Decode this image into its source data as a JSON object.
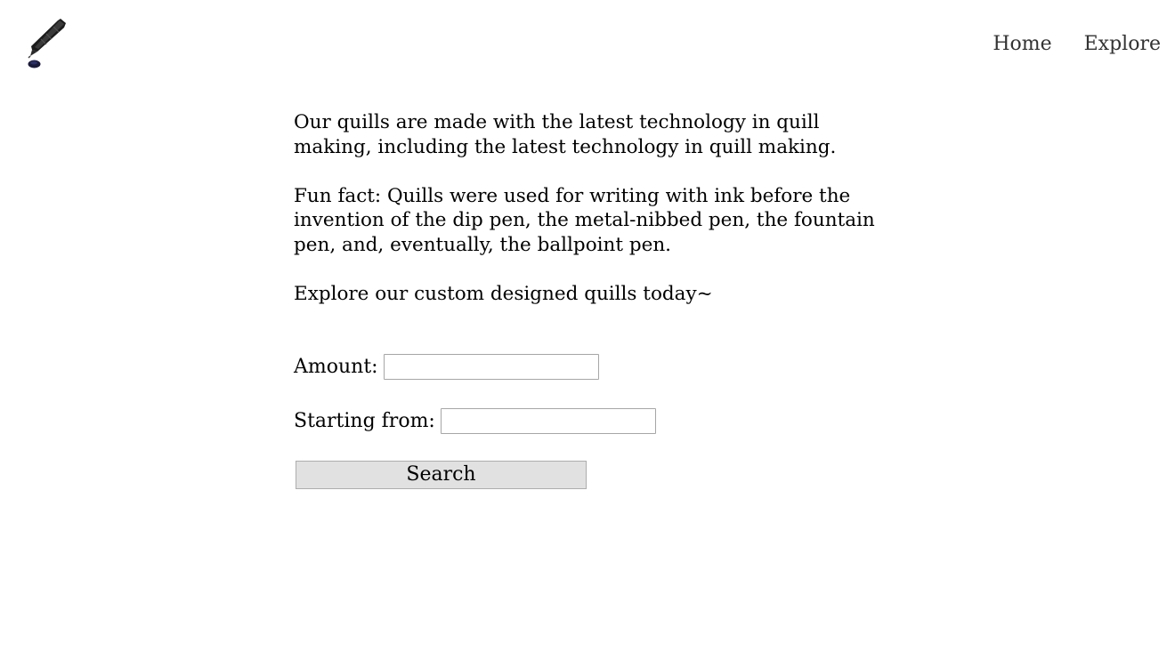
{
  "nav": {
    "items": [
      {
        "label": "Home"
      },
      {
        "label": "Explore"
      }
    ]
  },
  "logo": {
    "icon": "quill-pen-icon"
  },
  "content": {
    "paragraph_1": "Our quills are made with the latest technology in quill making, including the latest technology in quill making.",
    "paragraph_2": "Fun fact: Quills were used for writing with ink before the invention of the dip pen, the metal-nibbed pen, the fountain pen, and, eventually, the ballpoint pen.",
    "paragraph_3": "Explore our custom designed quills today~"
  },
  "form": {
    "amount_label": "Amount:",
    "amount_value": "",
    "starting_from_label": "Starting from:",
    "starting_from_value": "",
    "search_label": "Search"
  },
  "colors": {
    "nav_text": "#333333",
    "button_bg": "#e1e1e1",
    "input_border": "#a6a6a6"
  }
}
